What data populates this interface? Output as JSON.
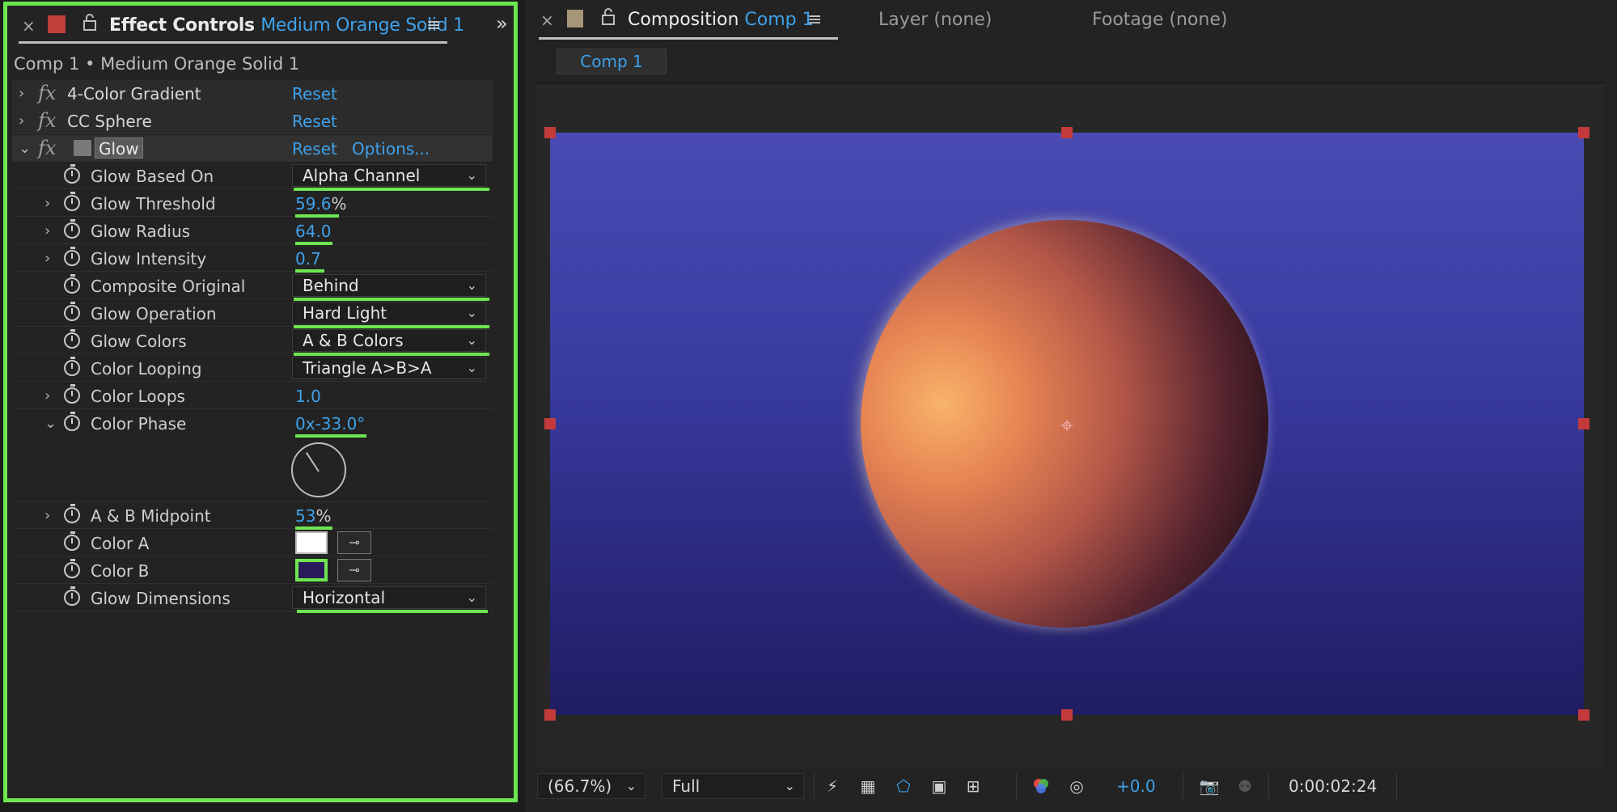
{
  "effect_controls": {
    "tab_title": "Effect Controls",
    "tab_layer": "Medium Orange Solid 1",
    "close_glyph": "×",
    "menu_glyph": "≡",
    "expand_glyph": "»",
    "breadcrumb": "Comp 1 • Medium Orange Solid 1",
    "effects": [
      {
        "name": "4-Color Gradient",
        "reset": "Reset"
      },
      {
        "name": "CC Sphere",
        "reset": "Reset"
      },
      {
        "name": "Glow",
        "reset": "Reset",
        "options": "Options..."
      }
    ],
    "properties": {
      "glow_based_on": {
        "label": "Glow Based On",
        "value": "Alpha Channel"
      },
      "glow_threshold": {
        "label": "Glow Threshold",
        "value": "59.6",
        "unit": "%"
      },
      "glow_radius": {
        "label": "Glow Radius",
        "value": "64.0"
      },
      "glow_intensity": {
        "label": "Glow Intensity",
        "value": "0.7"
      },
      "composite_original": {
        "label": "Composite Original",
        "value": "Behind"
      },
      "glow_operation": {
        "label": "Glow Operation",
        "value": "Hard Light"
      },
      "glow_colors": {
        "label": "Glow Colors",
        "value": "A & B Colors"
      },
      "color_looping": {
        "label": "Color Looping",
        "value": "Triangle A>B>A"
      },
      "color_loops": {
        "label": "Color Loops",
        "value": "1.0"
      },
      "color_phase": {
        "label": "Color Phase",
        "value": "0x-33.0°"
      },
      "ab_midpoint": {
        "label": "A & B Midpoint",
        "value": "53",
        "unit": "%"
      },
      "color_a": {
        "label": "Color A",
        "color": "#ffffff"
      },
      "color_b": {
        "label": "Color B",
        "color": "#2a1a5c"
      },
      "glow_dimensions": {
        "label": "Glow Dimensions",
        "value": "Horizontal"
      }
    },
    "highlight_color": "#6de650"
  },
  "composition": {
    "tab_title": "Composition",
    "tab_comp": "Comp 1",
    "layer_tab": "Layer (none)",
    "footage_tab": "Footage (none)",
    "subtab": "Comp 1",
    "toolbar": {
      "zoom": "(66.7%)",
      "resolution": "Full",
      "exposure": "+0.0",
      "timecode": "0:00:02:24"
    }
  }
}
